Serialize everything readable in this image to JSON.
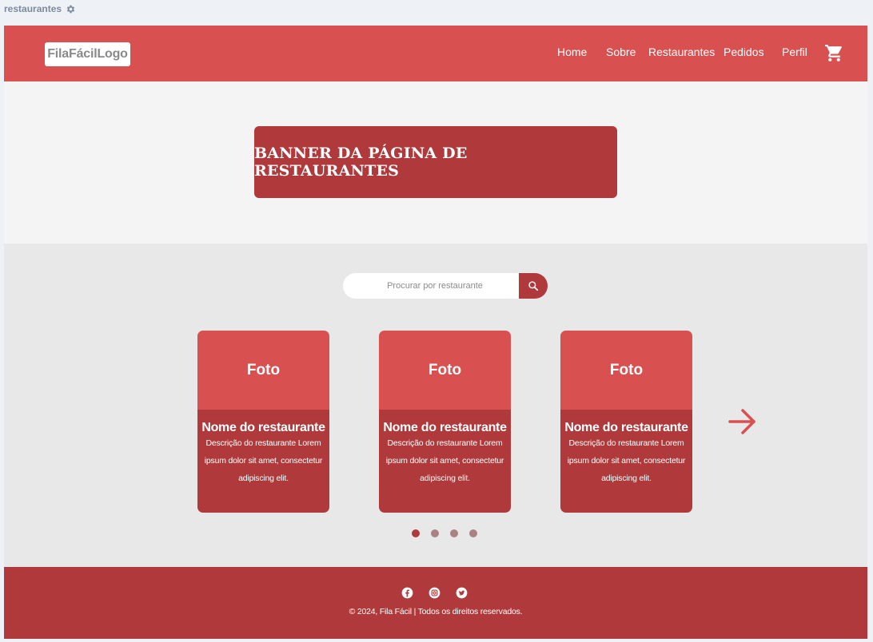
{
  "frame": {
    "label": "restaurantes",
    "icon": "gear-icon"
  },
  "header": {
    "logo": "FilaFácilLogo",
    "nav": [
      "Home",
      "Sobre",
      "Restaurantes",
      "Pedidos",
      "Perfil"
    ],
    "cart_icon": "cart-icon"
  },
  "banner": {
    "title": "BANNER DA PÁGINA DE RESTAURANTES"
  },
  "search": {
    "placeholder": "Procurar por restaurante",
    "icon": "search-icon"
  },
  "cards": [
    {
      "photo": "Foto",
      "name": "Nome do restaurante",
      "description": "Descrição do restaurante Lorem ipsum dolor sit amet, consectetur adipiscing elit."
    },
    {
      "photo": "Foto",
      "name": "Nome do restaurante",
      "description": "Descrição do restaurante Lorem ipsum dolor sit amet, consectetur adipiscing elit."
    },
    {
      "photo": "Foto",
      "name": "Nome do restaurante",
      "description": "Descrição do restaurante Lorem ipsum dolor sit amet, consectetur adipiscing elit."
    }
  ],
  "carousel": {
    "next_icon": "arrow-right-icon",
    "pages": 4,
    "active_page": 1
  },
  "footer": {
    "social_icons": [
      "facebook-icon",
      "instagram-icon",
      "twitter-icon"
    ],
    "copyright": "© 2024, Fila Fácil | Todos os direitos reservados."
  },
  "colors": {
    "primary": "#d85050",
    "primary_dark": "#b0393b",
    "background": "#e8e8e8"
  }
}
